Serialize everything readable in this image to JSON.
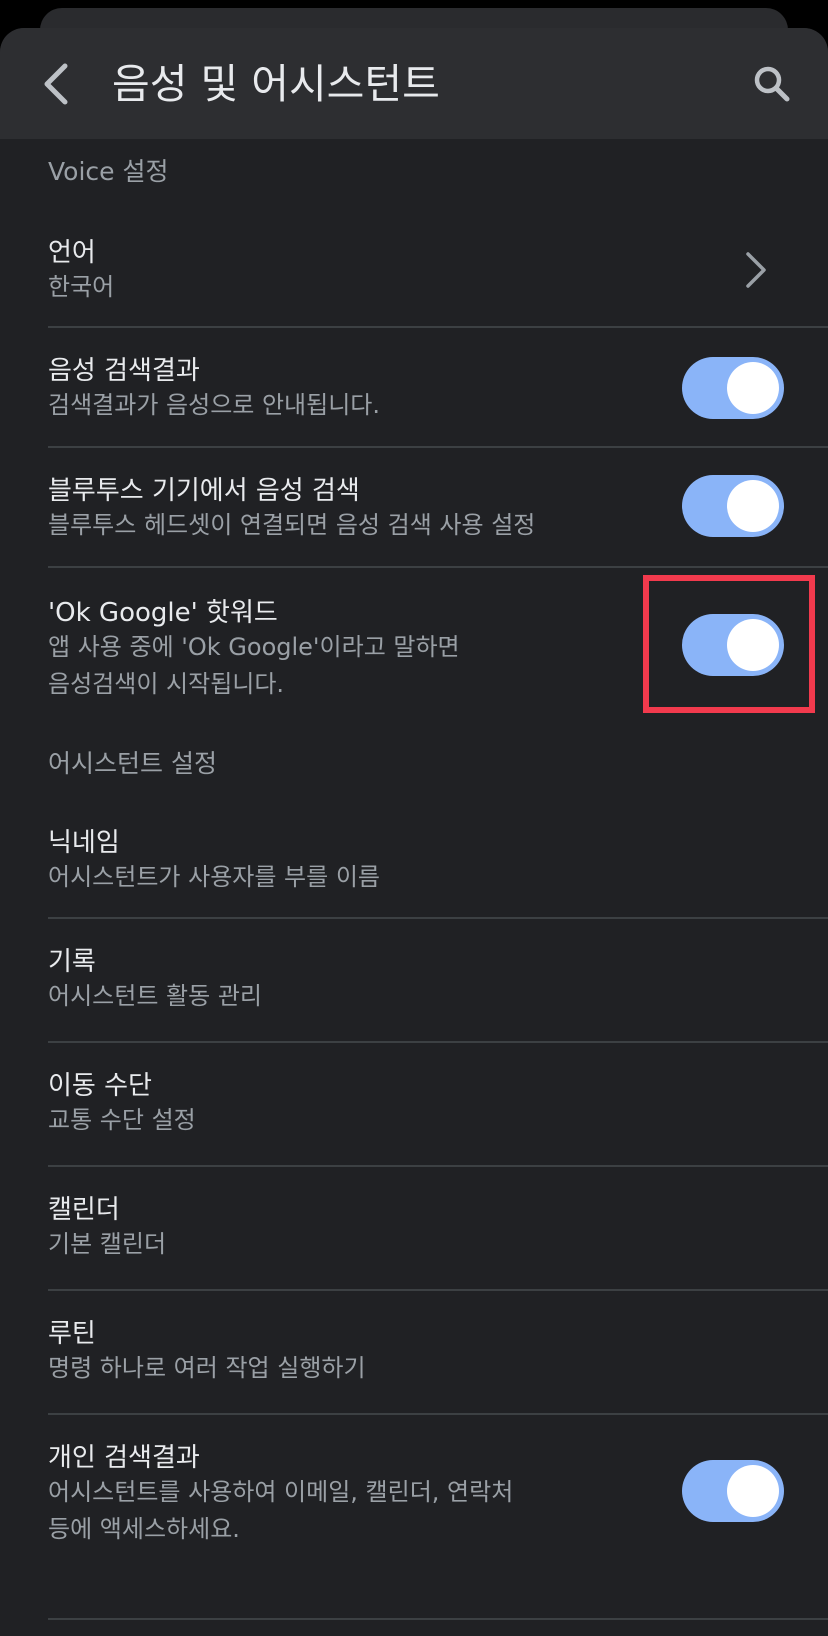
{
  "header": {
    "title": "음성 및 어시스턴트"
  },
  "sections": {
    "voice": "Voice 설정",
    "assistant": "어시스턴트 설정"
  },
  "items": {
    "language": {
      "title": "언어",
      "subtitle": "한국어"
    },
    "voice_results": {
      "title": "음성 검색결과",
      "subtitle": "검색결과가 음성으로 안내됩니다.",
      "enabled": true
    },
    "bluetooth": {
      "title": "블루투스 기기에서 음성 검색",
      "subtitle": "블루투스 헤드셋이 연결되면 음성 검색 사용 설정",
      "enabled": true
    },
    "hotword": {
      "title": "'Ok Google' 핫워드",
      "subtitle": "앱 사용 중에 'Ok Google'이라고 말하면\n음성검색이 시작됩니다.",
      "enabled": true
    },
    "nickname": {
      "title": "닉네임",
      "subtitle": "어시스턴트가 사용자를 부를 이름"
    },
    "history": {
      "title": "기록",
      "subtitle": "어시스턴트 활동 관리"
    },
    "transport": {
      "title": "이동 수단",
      "subtitle": "교통 수단 설정"
    },
    "calendar": {
      "title": "캘린더",
      "subtitle": "기본 캘린더"
    },
    "routines": {
      "title": "루틴",
      "subtitle": "명령 하나로 여러 작업 실행하기"
    },
    "personal_results": {
      "title": "개인 검색결과",
      "subtitle": "어시스턴트를 사용하여 이메일, 캘린더, 연락처\n등에 액세스하세요.",
      "enabled": true
    }
  },
  "colors": {
    "background": "#202124",
    "header": "#2d2e31",
    "toggle_on": "#8ab4f8",
    "highlight": "#f23a4d"
  }
}
